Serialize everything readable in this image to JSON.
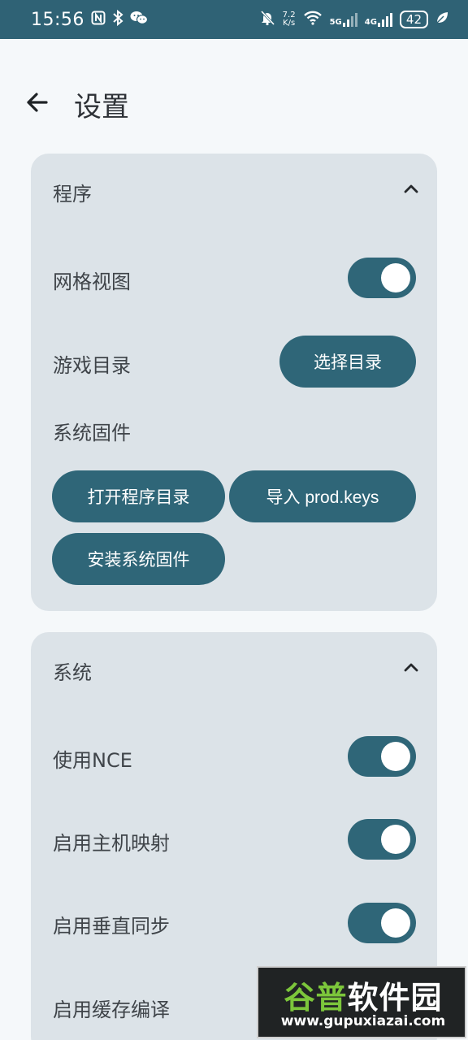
{
  "status_bar": {
    "time": "15:56",
    "net_speed_value": "7.2",
    "net_speed_unit": "K/s",
    "network_1": "5G",
    "network_2": "4G",
    "battery": "42",
    "icons": [
      "nfc-icon",
      "bluetooth-icon",
      "wechat-icon",
      "mute-bell-icon",
      "wifi-icon",
      "signal-icon",
      "signal-icon",
      "battery-icon",
      "leaf-icon"
    ]
  },
  "header": {
    "title": "设置",
    "back_icon": "arrow-left-icon"
  },
  "sections": {
    "program": {
      "title": "程序",
      "grid_view_label": "网格视图",
      "grid_view_on": true,
      "game_dir_label": "游戏目录",
      "game_dir_button": "选择目录",
      "firmware_label": "系统固件",
      "open_app_dir_button": "打开程序目录",
      "import_keys_button": "导入 prod.keys",
      "install_firmware_button": "安装系统固件"
    },
    "system": {
      "title": "系统",
      "nce_label": "使用NCE",
      "nce_on": true,
      "host_mapping_label": "启用主机映射",
      "host_mapping_on": true,
      "vsync_label": "启用垂直同步",
      "vsync_on": true,
      "cache_compile_label": "启用缓存编译"
    }
  },
  "colors": {
    "accent": "#2f6678",
    "status_bar": "#2f6275",
    "card_bg": "#dce3e8",
    "page_bg": "#f5f8fa"
  },
  "watermark": {
    "text_green": "谷普",
    "text_white": "软件园",
    "url": "www.gupuxiazai.com"
  }
}
